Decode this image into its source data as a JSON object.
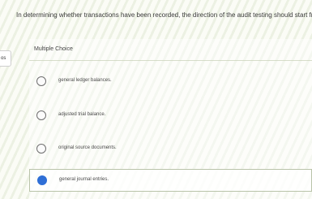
{
  "question": {
    "text": "In determining whether transactions have been recorded, the direction of the audit testing should start from the:"
  },
  "points_tab": {
    "label": "os"
  },
  "answer": {
    "type_label": "Multiple Choice",
    "options": [
      {
        "label": "general ledger balances.",
        "selected": false
      },
      {
        "label": "adjusted trial balance.",
        "selected": false
      },
      {
        "label": "original source documents.",
        "selected": false
      },
      {
        "label": "general journal entries.",
        "selected": true
      }
    ]
  },
  "colors": {
    "selected_radio": "#2f6fd6"
  }
}
